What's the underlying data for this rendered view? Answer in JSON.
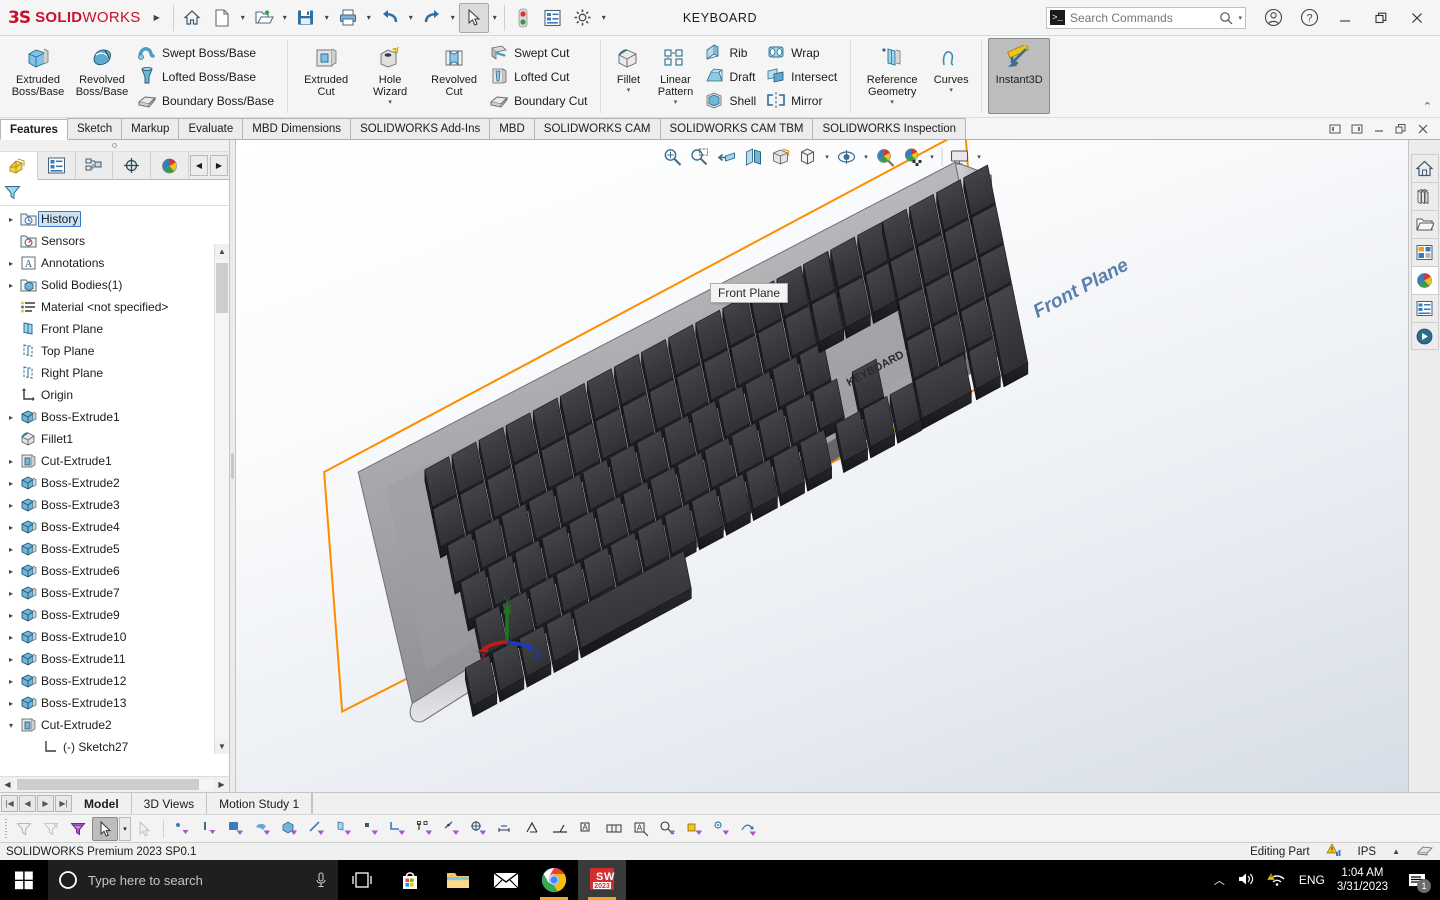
{
  "titlebar": {
    "brand_mark": "3S",
    "brand_solid": "SOLID",
    "brand_works": "WORKS",
    "document_title": "KEYBOARD",
    "quick_access": [
      {
        "name": "home-icon",
        "tip": "Home"
      },
      {
        "name": "new-document-icon",
        "tip": "New"
      },
      {
        "name": "open-document-icon",
        "tip": "Open"
      },
      {
        "name": "save-icon",
        "tip": "Save"
      },
      {
        "name": "print-icon",
        "tip": "Print"
      },
      {
        "name": "undo-icon",
        "tip": "Undo"
      },
      {
        "name": "redo-icon",
        "tip": "Redo"
      },
      {
        "name": "select-arrow-icon",
        "tip": "Select"
      },
      {
        "name": "rebuild-icon",
        "tip": "Rebuild"
      },
      {
        "name": "file-properties-icon",
        "tip": "File Properties"
      },
      {
        "name": "options-gear-icon",
        "tip": "Options"
      }
    ],
    "search_placeholder": "Search Commands",
    "search_prompt": ">_",
    "account_label": "Account",
    "help_label": "Help",
    "minimize_label": "Minimize",
    "restore_label": "Restore",
    "close_label": "Close"
  },
  "ribbon": {
    "groups": [
      {
        "big": [
          {
            "label_line1": "Extruded",
            "label_line2": "Boss/Base",
            "icon": "extruded-boss-icon",
            "dropdown": false
          },
          {
            "label_line1": "Revolved",
            "label_line2": "Boss/Base",
            "icon": "revolved-boss-icon",
            "dropdown": false
          }
        ],
        "small": [
          {
            "label": "Swept Boss/Base",
            "icon": "swept-boss-icon"
          },
          {
            "label": "Lofted Boss/Base",
            "icon": "lofted-boss-icon"
          },
          {
            "label": "Boundary Boss/Base",
            "icon": "boundary-boss-icon"
          }
        ]
      },
      {
        "big": [
          {
            "label_line1": "Extruded",
            "label_line2": "Cut",
            "icon": "extruded-cut-icon",
            "dropdown": false
          },
          {
            "label_line1": "Hole",
            "label_line2": "Wizard",
            "icon": "hole-wizard-icon",
            "dropdown": true
          },
          {
            "label_line1": "Revolved",
            "label_line2": "Cut",
            "icon": "revolved-cut-icon",
            "dropdown": false
          }
        ],
        "small": [
          {
            "label": "Swept Cut",
            "icon": "swept-cut-icon"
          },
          {
            "label": "Lofted Cut",
            "icon": "lofted-cut-icon"
          },
          {
            "label": "Boundary Cut",
            "icon": "boundary-cut-icon"
          }
        ]
      },
      {
        "big": [
          {
            "label_line1": "Fillet",
            "label_line2": "",
            "icon": "fillet-icon",
            "dropdown": true
          },
          {
            "label_line1": "Linear",
            "label_line2": "Pattern",
            "icon": "linear-pattern-icon",
            "dropdown": true
          }
        ],
        "small": [
          {
            "label": "Rib",
            "icon": "rib-icon"
          },
          {
            "label": "Draft",
            "icon": "draft-icon"
          },
          {
            "label": "Shell",
            "icon": "shell-icon"
          }
        ],
        "small2": [
          {
            "label": "Wrap",
            "icon": "wrap-icon"
          },
          {
            "label": "Intersect",
            "icon": "intersect-icon"
          },
          {
            "label": "Mirror",
            "icon": "mirror-icon"
          }
        ]
      },
      {
        "big": [
          {
            "label_line1": "Reference",
            "label_line2": "Geometry",
            "icon": "reference-geometry-icon",
            "dropdown": true
          },
          {
            "label_line1": "Curves",
            "label_line2": "",
            "icon": "curves-icon",
            "dropdown": true
          }
        ]
      },
      {
        "big": [
          {
            "label_line1": "Instant3D",
            "label_line2": "",
            "icon": "instant3d-icon",
            "dropdown": false,
            "active": true
          }
        ]
      }
    ],
    "collapse_label": "Collapse ribbon"
  },
  "tabs": [
    {
      "label": "Features",
      "active": true
    },
    {
      "label": "Sketch",
      "active": false
    },
    {
      "label": "Markup",
      "active": false
    },
    {
      "label": "Evaluate",
      "active": false
    },
    {
      "label": "MBD Dimensions",
      "active": false
    },
    {
      "label": "SOLIDWORKS Add-Ins",
      "active": false
    },
    {
      "label": "MBD",
      "active": false
    },
    {
      "label": "SOLIDWORKS CAM",
      "active": false
    },
    {
      "label": "SOLIDWORKS CAM TBM",
      "active": false
    },
    {
      "label": "SOLIDWORKS Inspection",
      "active": false
    }
  ],
  "document_window_buttons": [
    {
      "name": "restore-left-icon"
    },
    {
      "name": "restore-right-icon"
    },
    {
      "name": "doc-minimize-icon"
    },
    {
      "name": "doc-restore-icon"
    },
    {
      "name": "doc-close-icon"
    }
  ],
  "feature_manager": {
    "tabs": [
      {
        "name": "feature-manager-tree-tab",
        "icon": "feature-tree-icon",
        "active": true
      },
      {
        "name": "property-manager-tab",
        "icon": "property-manager-icon",
        "active": false
      },
      {
        "name": "configuration-manager-tab",
        "icon": "configuration-manager-icon",
        "active": false
      },
      {
        "name": "dimxpert-manager-tab",
        "icon": "dimxpert-icon",
        "active": false
      },
      {
        "name": "display-manager-tab",
        "icon": "display-manager-icon",
        "active": false
      }
    ],
    "filter_placeholder": "",
    "tree": [
      {
        "label": "History",
        "icon": "history-icon",
        "expandable": true,
        "expanded": false,
        "selected": true,
        "indent": 0
      },
      {
        "label": "Sensors",
        "icon": "sensors-icon",
        "expandable": false,
        "expanded": false,
        "selected": false,
        "indent": 0
      },
      {
        "label": "Annotations",
        "icon": "annotations-icon",
        "expandable": true,
        "expanded": false,
        "selected": false,
        "indent": 0
      },
      {
        "label": "Solid Bodies(1)",
        "icon": "solid-bodies-icon",
        "expandable": true,
        "expanded": false,
        "selected": false,
        "indent": 0
      },
      {
        "label": "Material <not specified>",
        "icon": "material-icon",
        "expandable": false,
        "expanded": false,
        "selected": false,
        "indent": 0
      },
      {
        "label": "Front Plane",
        "icon": "plane-front-icon",
        "expandable": false,
        "expanded": false,
        "selected": false,
        "indent": 0
      },
      {
        "label": "Top Plane",
        "icon": "plane-icon",
        "expandable": false,
        "expanded": false,
        "selected": false,
        "indent": 0
      },
      {
        "label": "Right Plane",
        "icon": "plane-icon",
        "expandable": false,
        "expanded": false,
        "selected": false,
        "indent": 0
      },
      {
        "label": "Origin",
        "icon": "origin-icon",
        "expandable": false,
        "expanded": false,
        "selected": false,
        "indent": 0
      },
      {
        "label": "Boss-Extrude1",
        "icon": "boss-extrude-icon",
        "expandable": true,
        "expanded": false,
        "selected": false,
        "indent": 0
      },
      {
        "label": "Fillet1",
        "icon": "fillet-feature-icon",
        "expandable": false,
        "expanded": false,
        "selected": false,
        "indent": 0
      },
      {
        "label": "Cut-Extrude1",
        "icon": "cut-extrude-icon",
        "expandable": true,
        "expanded": false,
        "selected": false,
        "indent": 0
      },
      {
        "label": "Boss-Extrude2",
        "icon": "boss-extrude-icon",
        "expandable": true,
        "expanded": false,
        "selected": false,
        "indent": 0
      },
      {
        "label": "Boss-Extrude3",
        "icon": "boss-extrude-icon",
        "expandable": true,
        "expanded": false,
        "selected": false,
        "indent": 0
      },
      {
        "label": "Boss-Extrude4",
        "icon": "boss-extrude-icon",
        "expandable": true,
        "expanded": false,
        "selected": false,
        "indent": 0
      },
      {
        "label": "Boss-Extrude5",
        "icon": "boss-extrude-icon",
        "expandable": true,
        "expanded": false,
        "selected": false,
        "indent": 0
      },
      {
        "label": "Boss-Extrude6",
        "icon": "boss-extrude-icon",
        "expandable": true,
        "expanded": false,
        "selected": false,
        "indent": 0
      },
      {
        "label": "Boss-Extrude7",
        "icon": "boss-extrude-icon",
        "expandable": true,
        "expanded": false,
        "selected": false,
        "indent": 0
      },
      {
        "label": "Boss-Extrude9",
        "icon": "boss-extrude-icon",
        "expandable": true,
        "expanded": false,
        "selected": false,
        "indent": 0
      },
      {
        "label": "Boss-Extrude10",
        "icon": "boss-extrude-icon",
        "expandable": true,
        "expanded": false,
        "selected": false,
        "indent": 0
      },
      {
        "label": "Boss-Extrude11",
        "icon": "boss-extrude-icon",
        "expandable": true,
        "expanded": false,
        "selected": false,
        "indent": 0
      },
      {
        "label": "Boss-Extrude12",
        "icon": "boss-extrude-icon",
        "expandable": true,
        "expanded": false,
        "selected": false,
        "indent": 0
      },
      {
        "label": "Boss-Extrude13",
        "icon": "boss-extrude-icon",
        "expandable": true,
        "expanded": false,
        "selected": false,
        "indent": 0
      },
      {
        "label": "Cut-Extrude2",
        "icon": "cut-extrude-icon",
        "expandable": true,
        "expanded": true,
        "selected": false,
        "indent": 0
      },
      {
        "label": "(-) Sketch27",
        "icon": "sketch-icon",
        "expandable": false,
        "expanded": false,
        "selected": false,
        "indent": 1
      }
    ]
  },
  "viewport": {
    "toolbar": [
      {
        "name": "zoom-to-fit-icon"
      },
      {
        "name": "zoom-to-area-icon"
      },
      {
        "name": "previous-view-icon"
      },
      {
        "name": "section-view-icon"
      },
      {
        "name": "view-orientation-icon"
      },
      {
        "name": "display-style-icon",
        "caret": true
      },
      {
        "name": "hide-show-items-icon",
        "caret": true
      },
      {
        "name": "edit-appearance-icon",
        "caret": true
      },
      {
        "name": "apply-scene-icon",
        "caret": true
      },
      {
        "name": "view-settings-icon",
        "caret": true
      }
    ],
    "plane_label": "Front Plane",
    "tooltip_text": "Front Plane",
    "model_brand_text": "KEYBOARD",
    "triad_axes": [
      "X",
      "Y",
      "Z"
    ],
    "selection_color": "#ff8c00"
  },
  "task_pane": [
    {
      "name": "task-pane-home-icon",
      "lit": false
    },
    {
      "name": "design-library-icon",
      "lit": false
    },
    {
      "name": "file-explorer-icon",
      "lit": false
    },
    {
      "name": "view-palette-icon",
      "lit": false
    },
    {
      "name": "appearances-scenes-icon",
      "lit": true
    },
    {
      "name": "custom-properties-icon",
      "lit": false
    },
    {
      "name": "3d-content-central-icon",
      "lit": false
    }
  ],
  "bottom_tabs": {
    "nav": [
      "first",
      "prev",
      "next",
      "last"
    ],
    "items": [
      {
        "label": "Model",
        "active": true
      },
      {
        "label": "3D Views",
        "active": false
      },
      {
        "label": "Motion Study 1",
        "active": false
      }
    ]
  },
  "filter_toolbar": {
    "buttons": [
      {
        "name": "filter-off-icon",
        "disabled": true,
        "selected": false
      },
      {
        "name": "clear-filters-icon",
        "disabled": true,
        "selected": false
      },
      {
        "name": "toggle-filters-icon",
        "disabled": false,
        "selected": false
      },
      {
        "name": "select-pointer-icon",
        "disabled": false,
        "selected": true
      },
      {
        "name": "select-other-icon",
        "disabled": true,
        "selected": false
      }
    ],
    "filters": [
      {
        "name": "filter-vertices-icon"
      },
      {
        "name": "filter-edges-icon"
      },
      {
        "name": "filter-faces-icon"
      },
      {
        "name": "filter-surface-bodies-icon"
      },
      {
        "name": "filter-solid-bodies-icon"
      },
      {
        "name": "filter-axes-icon"
      },
      {
        "name": "filter-planes-icon"
      },
      {
        "name": "filter-sketch-points-icon"
      },
      {
        "name": "filter-sketch-segments-icon"
      },
      {
        "name": "filter-midpoints-icon"
      },
      {
        "name": "filter-center-marks-icon"
      },
      {
        "name": "filter-centerlines-icon"
      },
      {
        "name": "filter-dimensions-icon"
      },
      {
        "name": "filter-surface-finish-icon"
      },
      {
        "name": "filter-weld-symbols-icon"
      },
      {
        "name": "filter-datums-icon"
      },
      {
        "name": "filter-feature-control-icon"
      },
      {
        "name": "filter-notes-icon"
      },
      {
        "name": "filter-balloons-icon"
      },
      {
        "name": "filter-blocks-icon"
      },
      {
        "name": "filter-connection-points-icon"
      },
      {
        "name": "filter-routing-points-icon"
      }
    ]
  },
  "status_bar": {
    "version": "SOLIDWORKS Premium 2023 SP0.1",
    "edit_mode": "Editing Part",
    "warning_icon": "warning-icon",
    "units": "IPS",
    "units_caret": "▲",
    "overlay_icon": "overlay-icon"
  },
  "taskbar": {
    "start_label": "Start",
    "search_placeholder": "Type here to search",
    "cortana_icon": "cortana-icon",
    "mic_icon": "microphone-icon",
    "apps": [
      {
        "name": "task-view-icon",
        "running": false,
        "active": false
      },
      {
        "name": "microsoft-store-icon",
        "running": false,
        "active": false
      },
      {
        "name": "file-explorer-taskbar-icon",
        "running": false,
        "active": false
      },
      {
        "name": "mail-icon",
        "running": false,
        "active": false
      },
      {
        "name": "google-chrome-icon",
        "running": true,
        "active": false
      },
      {
        "name": "solidworks-2023-icon",
        "running": true,
        "active": true
      }
    ],
    "tray": {
      "show_hidden_icon": "chevron-up-icon",
      "volume_icon": "speaker-icon",
      "network_icon": "network-warning-icon",
      "language": "ENG",
      "time": "1:04 AM",
      "date": "3/31/2023",
      "notification_count": "1"
    }
  }
}
